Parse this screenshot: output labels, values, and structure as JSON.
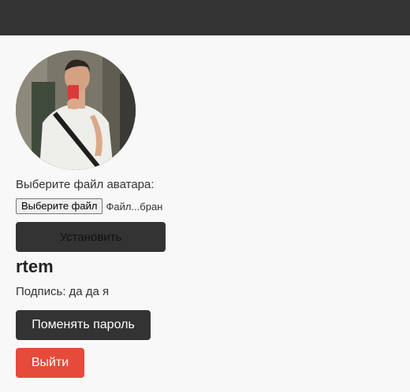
{
  "profile": {
    "avatar_label": "Выберите файл аватара:",
    "file_button_label": "Выберите файл",
    "file_status": "Файл...бран",
    "install_button_label": "Установить",
    "username": "rtem",
    "signature_label": "Подпись:",
    "signature_value": "да да я",
    "change_password_label": "Поменять пароль",
    "logout_label": "Выйти"
  },
  "colors": {
    "topbar": "#333333",
    "background": "#f8f8f8",
    "dark_button": "#333333",
    "logout_button": "#e64a3b"
  }
}
